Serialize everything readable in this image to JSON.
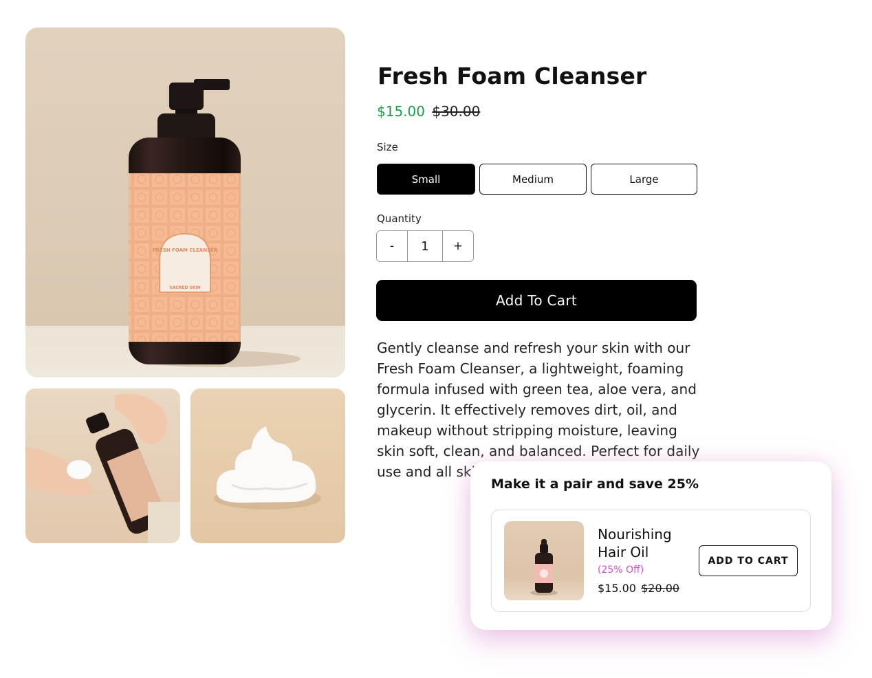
{
  "product": {
    "title": "Fresh Foam Cleanser",
    "price_sale": "$15.00",
    "price_original": "$30.00",
    "size_label": "Size",
    "sizes": [
      {
        "label": "Small",
        "selected": true
      },
      {
        "label": "Medium",
        "selected": false
      },
      {
        "label": "Large",
        "selected": false
      }
    ],
    "quantity_label": "Quantity",
    "quantity": {
      "minus": "-",
      "value": "1",
      "plus": "+"
    },
    "add_to_cart_label": "Add To Cart",
    "description": "Gently cleanse and refresh your skin with our Fresh Foam Cleanser, a lightweight, foaming formula infused with green tea, aloe vera, and glycerin. It effectively removes dirt, oil, and makeup without stripping moisture, leaving skin soft, clean, and balanced. Perfect for daily use and all ski"
  },
  "gallery": {
    "label_texts": [
      "FRESH FOAM CLEANSER",
      "SACRED SKIN"
    ]
  },
  "upsell": {
    "title": "Make it a pair and save 25%",
    "item": {
      "name": "Nourishing Hair Oil",
      "discount": "(25% Off)",
      "price_sale": "$15.00",
      "price_original": "$20.00",
      "button_label": "ADD TO CART"
    }
  },
  "colors": {
    "sale_price": "#1f9a4a",
    "discount": "#d44bc3",
    "primary_button": "#000000",
    "label_peach": "#f5b994"
  }
}
